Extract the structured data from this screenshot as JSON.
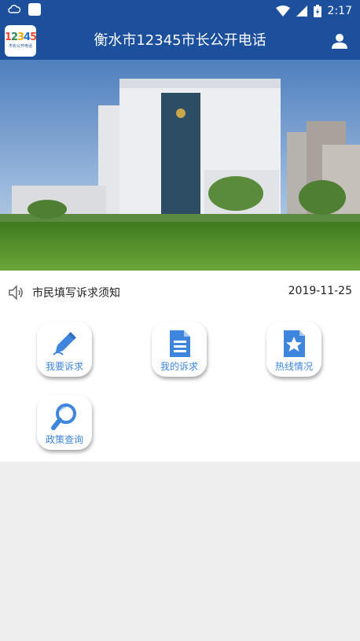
{
  "status_bar": {
    "time": "2:17"
  },
  "app_bar": {
    "logo_number": [
      "1",
      "2",
      "3",
      "4",
      "5"
    ],
    "logo_caption": "市长公开电话",
    "title": "衡水市12345市长公开电话"
  },
  "notice": {
    "text": "市民填写诉求须知",
    "date": "2019-11-25"
  },
  "menu": [
    {
      "label": "我要诉求",
      "icon": "pencil-icon"
    },
    {
      "label": "我的诉求",
      "icon": "document-icon"
    },
    {
      "label": "热线情况",
      "icon": "star-document-icon"
    },
    {
      "label": "政策查询",
      "icon": "magnifier-icon"
    }
  ],
  "colors": {
    "primary": "#1c4f9c",
    "accent": "#3e85dd",
    "background": "#eeeeee"
  }
}
